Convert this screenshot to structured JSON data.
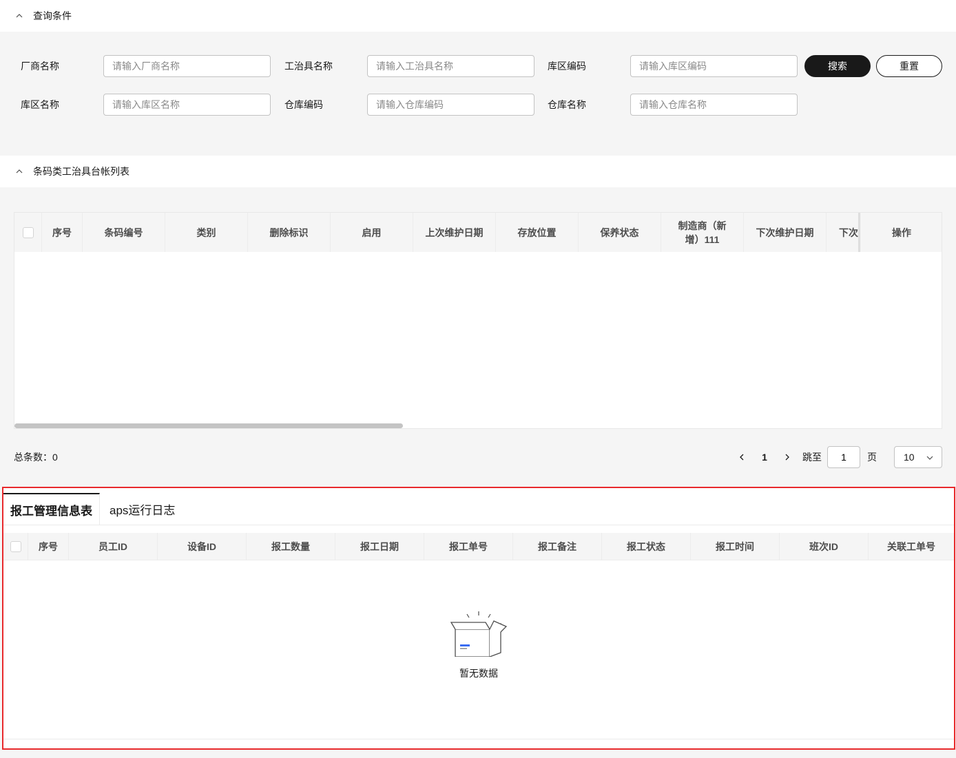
{
  "query": {
    "title": "查询条件",
    "fields": [
      {
        "label": "厂商名称",
        "placeholder": "请输入厂商名称"
      },
      {
        "label": "工治具名称",
        "placeholder": "请输入工治具名称"
      },
      {
        "label": "库区编码",
        "placeholder": "请输入库区编码"
      },
      {
        "label": "库区名称",
        "placeholder": "请输入库区名称"
      },
      {
        "label": "仓库编码",
        "placeholder": "请输入仓库编码"
      },
      {
        "label": "仓库名称",
        "placeholder": "请输入仓库名称"
      }
    ],
    "search_label": "搜索",
    "reset_label": "重置"
  },
  "list": {
    "title": "条码类工治具台帐列表",
    "columns": [
      "序号",
      "条码编号",
      "类别",
      "删除标识",
      "启用",
      "上次维护日期",
      "存放位置",
      "保养状态",
      "制造商（新增）111",
      "下次维护日期",
      "下次"
    ],
    "fixed_column": "操作"
  },
  "pagination": {
    "total_label": "总条数：0",
    "current_page": "1",
    "jump_label": "跳至",
    "jump_value": "1",
    "page_suffix": "页",
    "page_size": "10"
  },
  "tabs": {
    "items": [
      "报工管理信息表",
      "aps运行日志"
    ],
    "active_index": 0
  },
  "report_table": {
    "columns": [
      "序号",
      "员工ID",
      "设备ID",
      "报工数量",
      "报工日期",
      "报工单号",
      "报工备注",
      "报工状态",
      "报工时间",
      "班次ID",
      "关联工单号"
    ],
    "empty_text": "暂无数据"
  },
  "colors": {
    "primary": "#191919",
    "highlight_border": "#e8292c",
    "empty_icon_accent": "#3b6df2"
  }
}
